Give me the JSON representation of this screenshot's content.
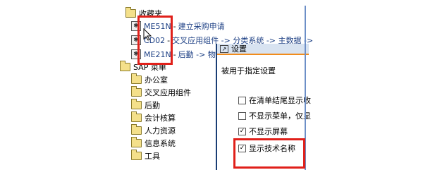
{
  "favorites": {
    "header": "收藏夹",
    "items": [
      {
        "code": "ME51N",
        "desc": "建立采购申请",
        "icon": "transaction-icon"
      },
      {
        "code": "CD02",
        "desc": "交叉应用组件 -> 分类系统 -> 主数据 ->",
        "icon": "transaction-icon"
      },
      {
        "code": "ME21N",
        "desc": "后勤 -> 物料",
        "icon": "transaction-icon"
      }
    ]
  },
  "sap_menu": {
    "header": "SAP 菜单",
    "items": [
      "办公室",
      "交叉应用组件",
      "后勤",
      "会计核算",
      "人力资源",
      "信息系统",
      "工具"
    ]
  },
  "dialog": {
    "title": "设置",
    "subtitle": "被用于指定设置",
    "options": [
      {
        "label": "在清单结尾显示收",
        "checked": false
      },
      {
        "label": "不显示菜单，仅显",
        "checked": false
      },
      {
        "label": "不显示屏幕",
        "checked": true
      },
      {
        "label": "显示技术名称",
        "checked": true
      }
    ]
  },
  "colors": {
    "highlight": "#e0201a",
    "accent": "#1c3f84",
    "dialog_border": "#f18c1c"
  }
}
